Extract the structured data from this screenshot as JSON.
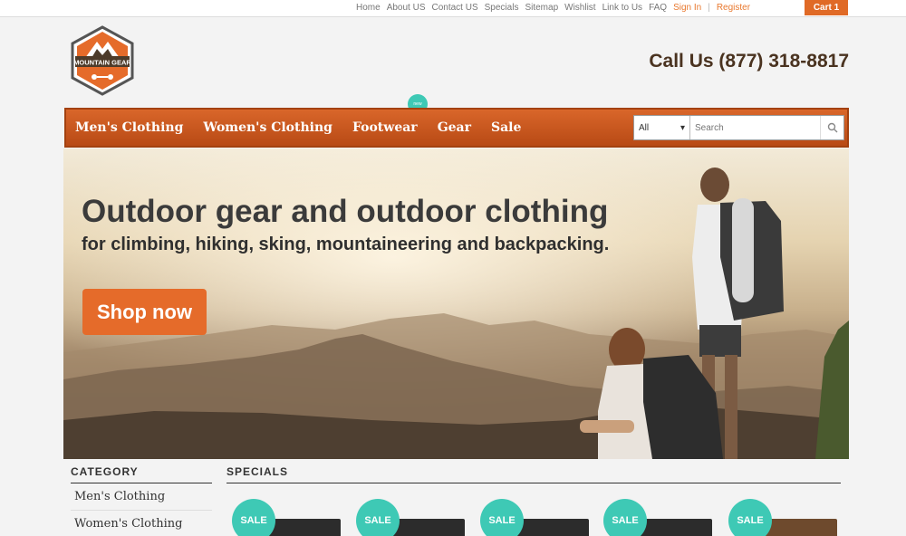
{
  "top_links": [
    "Home",
    "About US",
    "Contact US",
    "Specials",
    "Sitemap",
    "Wishlist",
    "Link to Us",
    "FAQ"
  ],
  "account": {
    "sign_in": "Sign In",
    "register": "Register"
  },
  "cart": {
    "label": "Cart 1"
  },
  "logo": {
    "text": "MOUNTAIN GEAR"
  },
  "phone": "Call Us (877) 318-8817",
  "nav": {
    "items": [
      "Men's Clothing",
      "Women's Clothing",
      "Footwear",
      "Gear",
      "Sale"
    ],
    "badge": "new"
  },
  "search": {
    "category": "All",
    "placeholder": "Search"
  },
  "hero": {
    "title": "Outdoor gear and outdoor clothing",
    "subtitle": "for climbing, hiking, sking, mountaineering and backpacking.",
    "button": "Shop now"
  },
  "category": {
    "heading": "CATEGORY",
    "items": [
      "Men's Clothing",
      "Women's Clothing"
    ]
  },
  "specials": {
    "heading": "SPECIALS",
    "badge": "SALE",
    "count": 5
  },
  "colors": {
    "accent": "#e06a26",
    "teal": "#3ec9b5",
    "nav_dark": "#b84a15"
  }
}
